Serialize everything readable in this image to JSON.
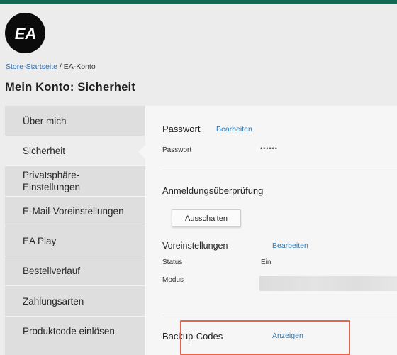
{
  "brand": {
    "logo_text": "EA"
  },
  "breadcrumb": {
    "home": "Store-Startseite",
    "separator": " / ",
    "current": "EA-Konto"
  },
  "page_title": "Mein Konto: Sicherheit",
  "sidebar": {
    "items": [
      {
        "label": "Über mich"
      },
      {
        "label": "Sicherheit",
        "active": true
      },
      {
        "label": "Privatsphäre-\nEinstellungen"
      },
      {
        "label": "E-Mail-Voreinstellungen"
      },
      {
        "label": "EA Play"
      },
      {
        "label": "Bestellverlauf"
      },
      {
        "label": "Zahlungsarten"
      },
      {
        "label": "Produktcode einlösen"
      }
    ]
  },
  "security": {
    "password": {
      "title": "Passwort",
      "edit_link": "Bearbeiten",
      "label": "Passwort",
      "value": "••••••"
    },
    "login_verification": {
      "title": "Anmeldungsüberprüfung",
      "button": "Ausschalten",
      "preferences_title": "Voreinstellungen",
      "preferences_link": "Bearbeiten",
      "status_label": "Status",
      "status_value": "Ein",
      "mode_label": "Modus"
    },
    "backup_codes": {
      "title": "Backup-Codes",
      "link": "Anzeigen"
    }
  },
  "colors": {
    "accent_link": "#2a7ab8",
    "highlight_box": "#e0644f",
    "background_outer": "#0f6a53"
  }
}
